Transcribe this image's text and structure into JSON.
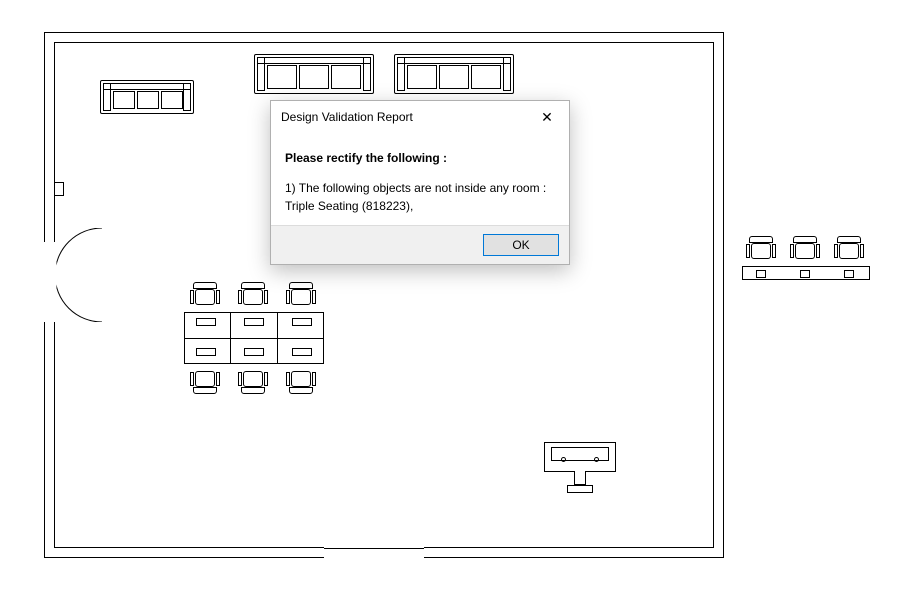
{
  "dialog": {
    "title": "Design Validation Report",
    "close_label": "✕",
    "instruction": "Please rectify the following :",
    "item1_line1": "1) The following objects are not inside any room :",
    "item1_line2": "Triple Seating (818223),",
    "ok_label": "OK"
  },
  "floorplan": {
    "objects": [
      {
        "type": "Sofa",
        "location": "top-left inside room"
      },
      {
        "type": "Sofa",
        "location": "top-center inside room (left)"
      },
      {
        "type": "Sofa",
        "location": "top-center inside room (right)"
      },
      {
        "type": "Desk cluster with 6 chairs",
        "location": "center-left inside room"
      },
      {
        "type": "Podium/Display unit",
        "location": "bottom-right inside room"
      },
      {
        "type": "Triple Seating",
        "id": "818223",
        "location": "outside room, right side"
      }
    ]
  }
}
